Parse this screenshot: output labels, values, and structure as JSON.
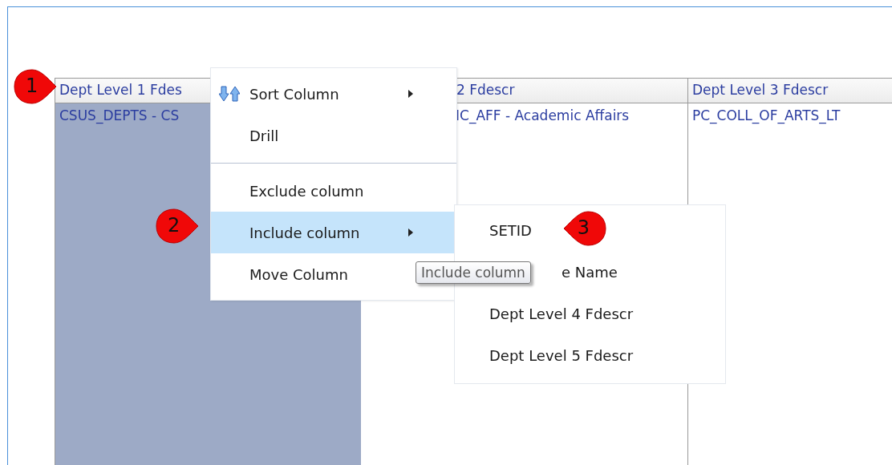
{
  "table": {
    "columns": [
      {
        "header": "Dept Level 1 Fdes",
        "selected": true
      },
      {
        "header": "2 Fdescr",
        "selected": false
      },
      {
        "header": "Dept Level 3 Fdescr",
        "selected": false
      }
    ],
    "rows": [
      [
        "CSUS_DEPTS - CS",
        "IC_AFF - Academic Affairs",
        "PC_COLL_OF_ARTS_LT"
      ]
    ]
  },
  "context_menu": {
    "items": [
      {
        "label": "Sort Column",
        "kind": "sort",
        "has_submenu": true,
        "selected": false
      },
      {
        "label": "Drill",
        "kind": "plain",
        "has_submenu": false,
        "selected": false
      },
      {
        "kind": "separator"
      },
      {
        "label": "Exclude column",
        "kind": "plain",
        "has_submenu": false,
        "selected": false
      },
      {
        "label": "Include column",
        "kind": "plain",
        "has_submenu": true,
        "selected": true
      },
      {
        "label": "Move Column",
        "kind": "plain",
        "has_submenu": false,
        "selected": false
      }
    ]
  },
  "submenu": {
    "items": [
      {
        "label": "SETID",
        "covered_by_tooltip": false
      },
      {
        "label": "e Name",
        "covered_by_tooltip": true
      },
      {
        "label": "Dept Level 4 Fdescr",
        "covered_by_tooltip": false
      },
      {
        "label": "Dept Level 5 Fdescr",
        "covered_by_tooltip": false
      }
    ]
  },
  "tooltip": {
    "text": "Include column"
  },
  "callouts": [
    {
      "number": "1"
    },
    {
      "number": "2"
    },
    {
      "number": "3"
    }
  ]
}
